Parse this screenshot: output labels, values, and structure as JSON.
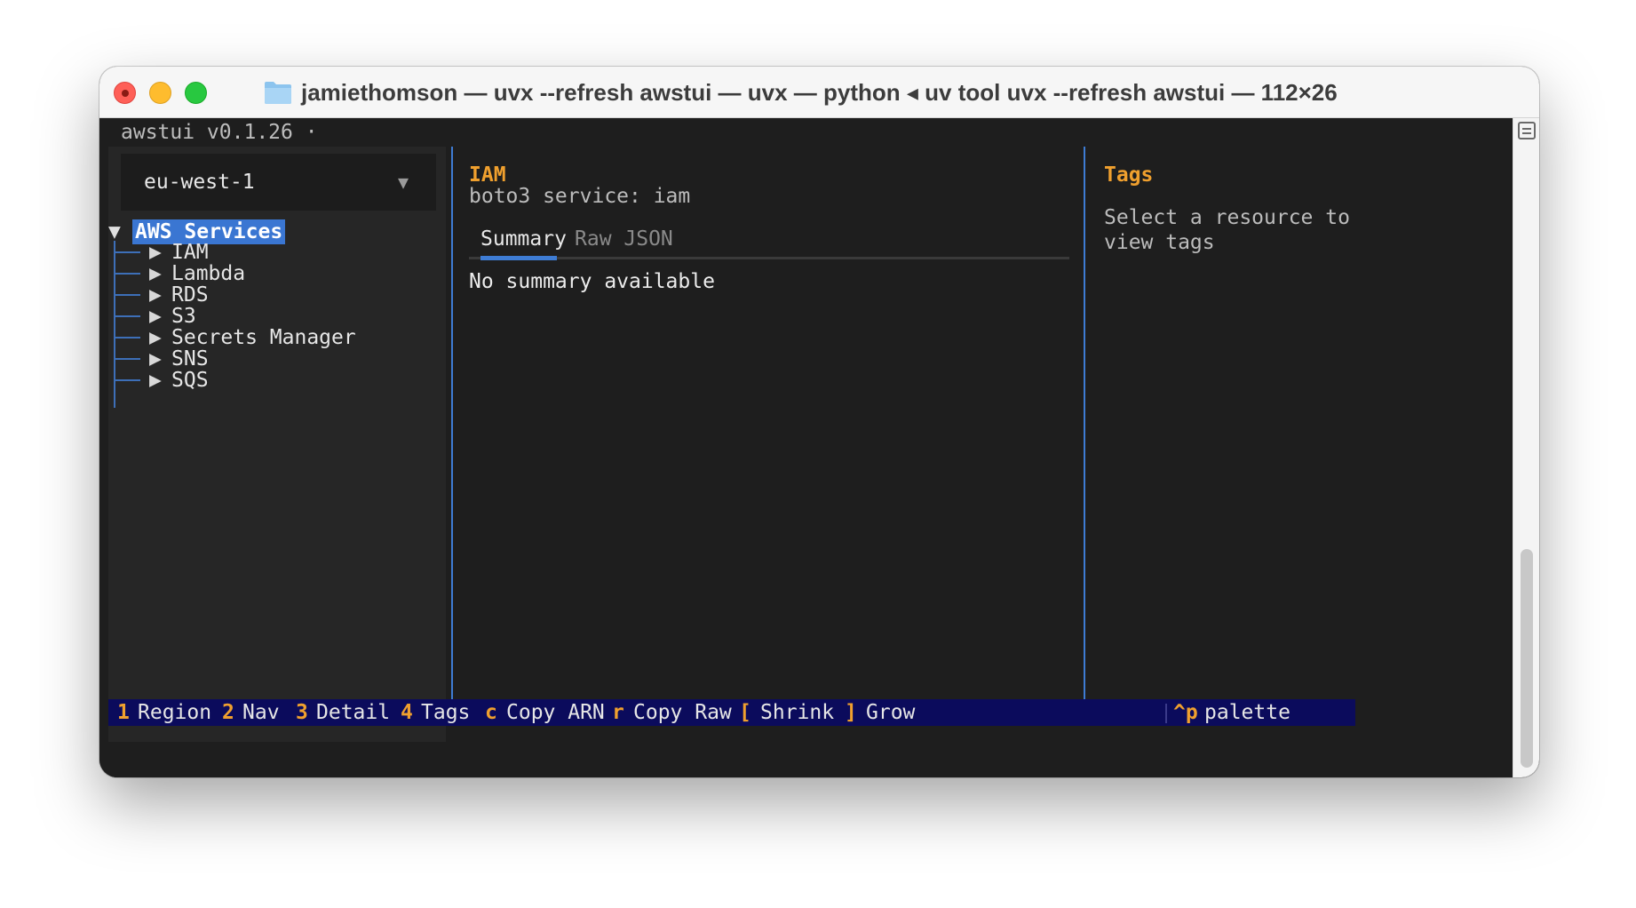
{
  "window": {
    "title": "jamiethomson — uvx --refresh awstui — uvx — python ◂ uv tool uvx --refresh awstui — 112×26",
    "title_icon": "folder-icon"
  },
  "app": {
    "header": "awstui v0.1.26 ·"
  },
  "region": {
    "value": "eu-west-1",
    "caret": "▼"
  },
  "tree": {
    "root_caret": "▼",
    "root_label": "AWS Services",
    "item_caret": "▶",
    "items": [
      {
        "label": "IAM"
      },
      {
        "label": "Lambda"
      },
      {
        "label": "RDS"
      },
      {
        "label": "S3"
      },
      {
        "label": "Secrets Manager"
      },
      {
        "label": "SNS"
      },
      {
        "label": "SQS"
      }
    ]
  },
  "detail": {
    "title": "IAM",
    "subtitle": "boto3 service: iam",
    "tabs": [
      {
        "label": "Summary",
        "active": true
      },
      {
        "label": "Raw JSON",
        "active": false
      }
    ],
    "body": "No summary available"
  },
  "tags": {
    "title": "Tags",
    "body": "Select a resource to view tags"
  },
  "statusbar": {
    "bindings": [
      {
        "key": "1",
        "label": "Region"
      },
      {
        "key": "2",
        "label": "Nav"
      },
      {
        "key": "3",
        "label": "Detail"
      },
      {
        "key": "4",
        "label": "Tags"
      },
      {
        "key": "c",
        "label": "Copy ARN"
      },
      {
        "key": "r",
        "label": "Copy Raw"
      },
      {
        "key": "[",
        "label": "Shrink"
      },
      {
        "key": "]",
        "label": "Grow"
      }
    ],
    "palette": {
      "key": "^p",
      "label": "palette"
    }
  },
  "colors": {
    "accent": "#3e7cd4",
    "highlight": "#3a76d2",
    "heading": "#f0a02e",
    "statusbar_bg": "#0b0b5c",
    "terminal_bg": "#1e1e1e"
  }
}
